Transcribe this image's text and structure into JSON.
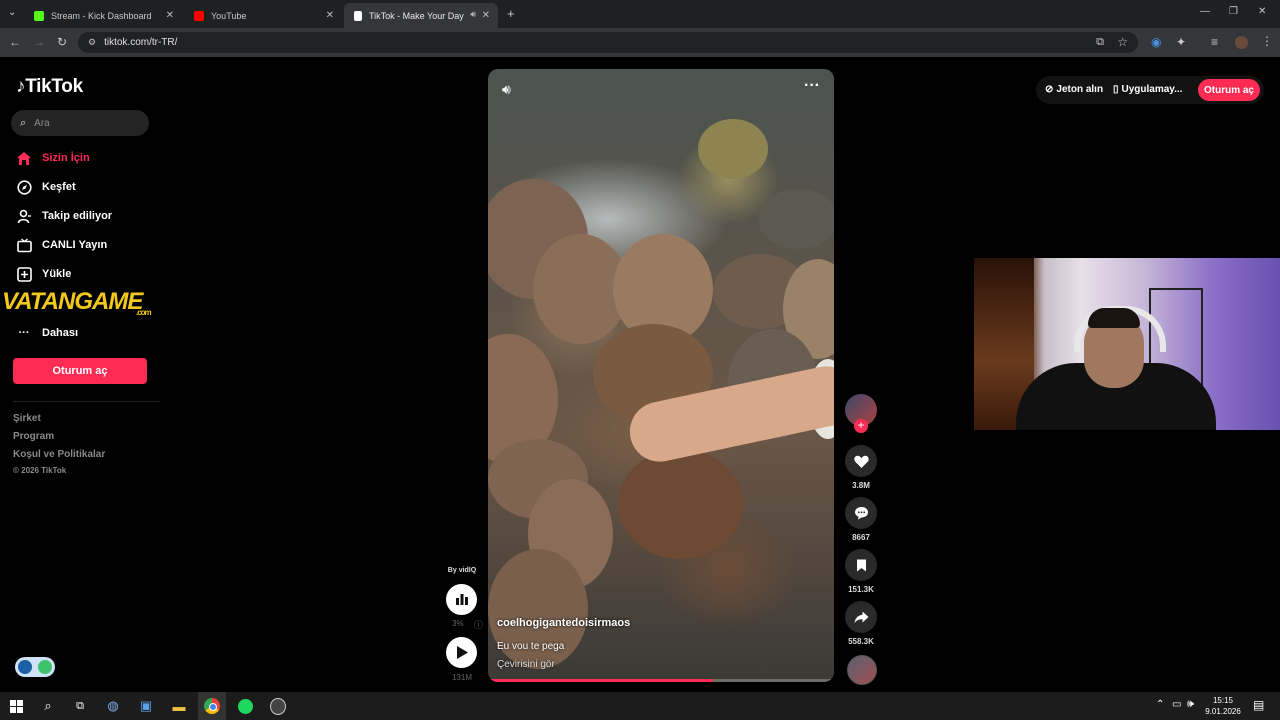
{
  "browser": {
    "tabs": [
      {
        "title": "Stream - Kick Dashboard",
        "favicon_color": "#53fc18",
        "favicon_icon": "kick-icon"
      },
      {
        "title": "YouTube",
        "favicon_color": "#ff0000",
        "favicon_icon": "youtube-icon"
      },
      {
        "title": "TikTok - Make Your Day",
        "favicon_color": "#000000",
        "favicon_icon": "tiktok-icon",
        "active": true
      }
    ],
    "url": "tiktok.com/tr-TR/"
  },
  "sidebar": {
    "logo": "TikTok",
    "search_placeholder": "Ara",
    "nav": [
      {
        "label": "Sizin İçin",
        "icon": "home-icon",
        "active": true
      },
      {
        "label": "Keşfet",
        "icon": "compass-icon"
      },
      {
        "label": "Takip ediliyor",
        "icon": "user-icon"
      },
      {
        "label": "CANLI Yayın",
        "icon": "live-tv-icon"
      },
      {
        "label": "Yükle",
        "icon": "upload-icon"
      },
      {
        "label": "Dahası",
        "icon": "more-icon"
      }
    ],
    "login_label": "Oturum aç",
    "footer": [
      "Şirket",
      "Program",
      "Koşul ve Politikalar"
    ],
    "copyright": "© 2026 TikTok"
  },
  "watermark": {
    "brand": "VATANGAME",
    "suffix": ".com"
  },
  "video": {
    "username": "coelhogigantedoisirmaos",
    "caption": "Eu vou te pega",
    "translate": "Çevirisini gör",
    "progress": 0.65
  },
  "actions": {
    "likes": "3.8M",
    "comments": "8667",
    "saves": "151.3K",
    "shares": "558.3K"
  },
  "vidiq": {
    "by": "By vidIQ",
    "percent": "3%",
    "views": "131M"
  },
  "topright": {
    "coins": "Jeton alın",
    "app": "Uygulamay...",
    "login": "Oturum aç"
  },
  "taskbar": {
    "time": "15:15",
    "date": "9.01.2026"
  },
  "colors": {
    "accent": "#fe2c55"
  }
}
